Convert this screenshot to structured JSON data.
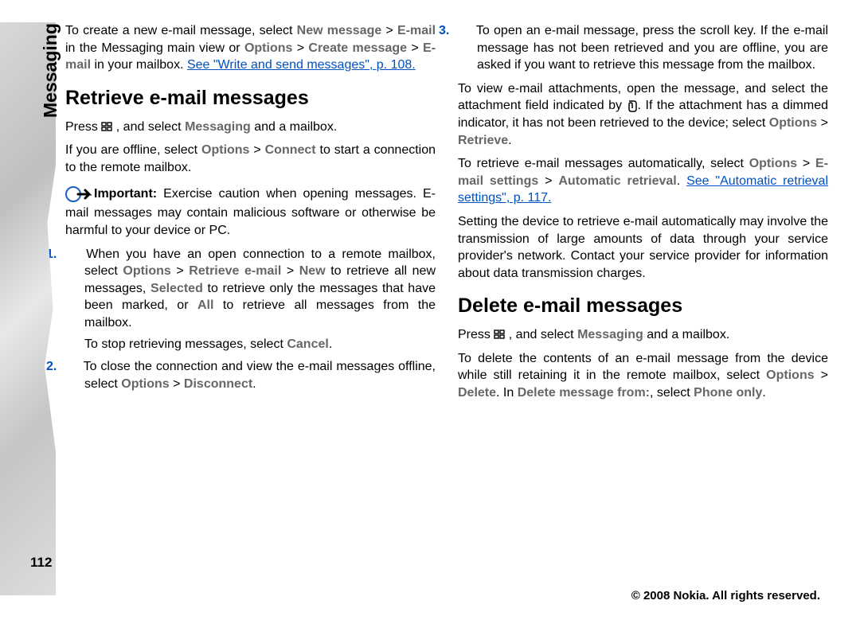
{
  "sidebar": {
    "title": "Messaging",
    "page_number": "112"
  },
  "footer": "© 2008 Nokia. All rights reserved.",
  "left": {
    "p1_a": "To create a new e-mail message, select ",
    "p1_b": "New message",
    "p1_c": " > ",
    "p1_d": "E-mail",
    "p1_e": " in the Messaging main view or ",
    "p1_f": "Options",
    "p1_g": " > ",
    "p1_h": "Create message",
    "p1_i": " > ",
    "p1_j": "E-mail",
    "p1_k": " in your mailbox. ",
    "p1_link": "See \"Write and send messages\", p. 108.",
    "h1": "Retrieve e-mail messages",
    "p2_a": "Press ",
    "p2_b": " , and select ",
    "p2_c": "Messaging",
    "p2_d": " and a mailbox.",
    "p3_a": "If you are offline, select ",
    "p3_b": "Options",
    "p3_c": " > ",
    "p3_d": "Connect",
    "p3_e": " to start a connection to the remote mailbox.",
    "imp_label": "Important:",
    "imp_text": "  Exercise caution when opening messages. E-mail messages may contain malicious software or otherwise be harmful to your device or PC.",
    "li1_n": "1.",
    "li1_a": "When you have an open connection to a remote mailbox, select ",
    "li1_b": "Options",
    "li1_c": " > ",
    "li1_d": "Retrieve e-mail",
    "li1_e": " > ",
    "li1_f": "New",
    "li1_g": " to retrieve all new messages, ",
    "li1_h": "Selected",
    "li1_i": " to retrieve only the messages that have been marked, or ",
    "li1_j": "All",
    "li1_k": " to retrieve all messages from the mailbox.",
    "li1_stop_a": "To stop retrieving messages, select ",
    "li1_stop_b": "Cancel",
    "li1_stop_c": ".",
    "li2_n": "2.",
    "li2_a": "To close the connection and view the e-mail messages offline, select ",
    "li2_b": "Options",
    "li2_c": " > ",
    "li2_d": "Disconnect",
    "li2_e": "."
  },
  "right": {
    "li3_n": "3.",
    "li3_a": "To open an e-mail message, press the scroll key. If the e-mail message has not been retrieved and you are offline, you are asked if you want to retrieve this message from the mailbox.",
    "p4_a": "To view e-mail attachments, open the message, and select the attachment field indicated by ",
    "p4_b": ". If the attachment has a dimmed indicator, it has not been retrieved to the device; select ",
    "p4_c": "Options",
    "p4_d": " > ",
    "p4_e": "Retrieve",
    "p4_f": ".",
    "p5_a": "To retrieve e-mail messages automatically, select ",
    "p5_b": "Options",
    "p5_c": " > ",
    "p5_d": "E-mail settings",
    "p5_e": " > ",
    "p5_f": "Automatic retrieval",
    "p5_g": ". ",
    "p5_link": "See \"Automatic retrieval settings\", p. 117.",
    "p6": "Setting the device to retrieve e-mail automatically may involve the transmission of large amounts of data through your service provider's network. Contact your service provider for information about data transmission charges.",
    "h2": "Delete e-mail messages",
    "p7_a": "Press ",
    "p7_b": " , and select ",
    "p7_c": "Messaging",
    "p7_d": " and a mailbox.",
    "p8_a": "To delete the contents of an e-mail message from the device while still retaining it in the remote mailbox, select ",
    "p8_b": "Options",
    "p8_c": " > ",
    "p8_d": "Delete",
    "p8_e": ". In ",
    "p8_f": "Delete message from:",
    "p8_g": ", select ",
    "p8_h": "Phone only",
    "p8_i": "."
  }
}
